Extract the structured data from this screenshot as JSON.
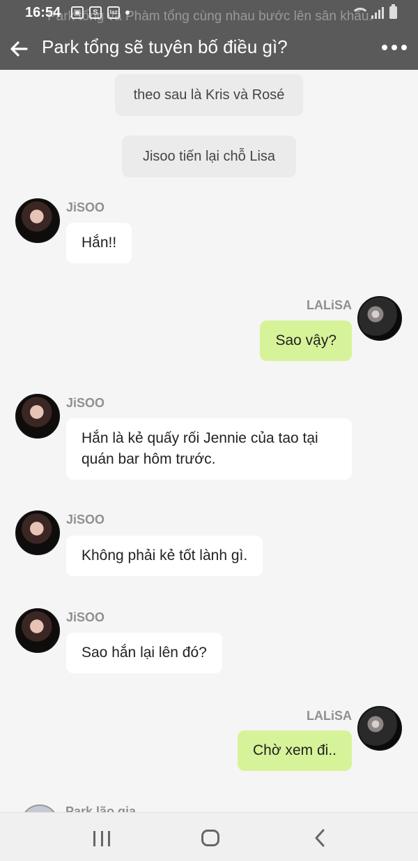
{
  "status_bar": {
    "time": "16:54",
    "icons": [
      "gallery-icon",
      "shopee-icon",
      "lazada-icon",
      "dot-icon"
    ],
    "lazada_label": "laz",
    "shopee_label": "S"
  },
  "notification_overlay": "Park tổng và Phàm tổng cùng nhau bước lên sân khấu.",
  "header": {
    "title": "Park tổng sẽ tuyên bố điều gì?"
  },
  "messages": [
    {
      "type": "narration",
      "text": "theo sau là Kris và Rosé"
    },
    {
      "type": "narration",
      "text": "Jisoo tiến lại chỗ Lisa"
    },
    {
      "type": "left",
      "sender": "JiSOO",
      "text": "Hắn!!"
    },
    {
      "type": "right",
      "sender": "LALiSA",
      "text": "Sao vậy?"
    },
    {
      "type": "left",
      "sender": "JiSOO",
      "text": "Hắn là kẻ quấy rối Jennie của tao tại quán bar hôm trước."
    },
    {
      "type": "left",
      "sender": "JiSOO",
      "text": "Không phải kẻ tốt lành gì."
    },
    {
      "type": "left",
      "sender": "JiSOO",
      "text": "Sao hắn lại lên đó?"
    },
    {
      "type": "right",
      "sender": "LALiSA",
      "text": "Chờ xem đi.."
    },
    {
      "type": "left",
      "sender": "Park lão gia",
      "text": ""
    }
  ],
  "colors": {
    "header_bg": "#5a5a5a",
    "chat_bg": "#f5f5f5",
    "my_bubble": "#d7f399",
    "their_bubble": "#ffffff",
    "narration_bubble": "#ebebeb"
  }
}
